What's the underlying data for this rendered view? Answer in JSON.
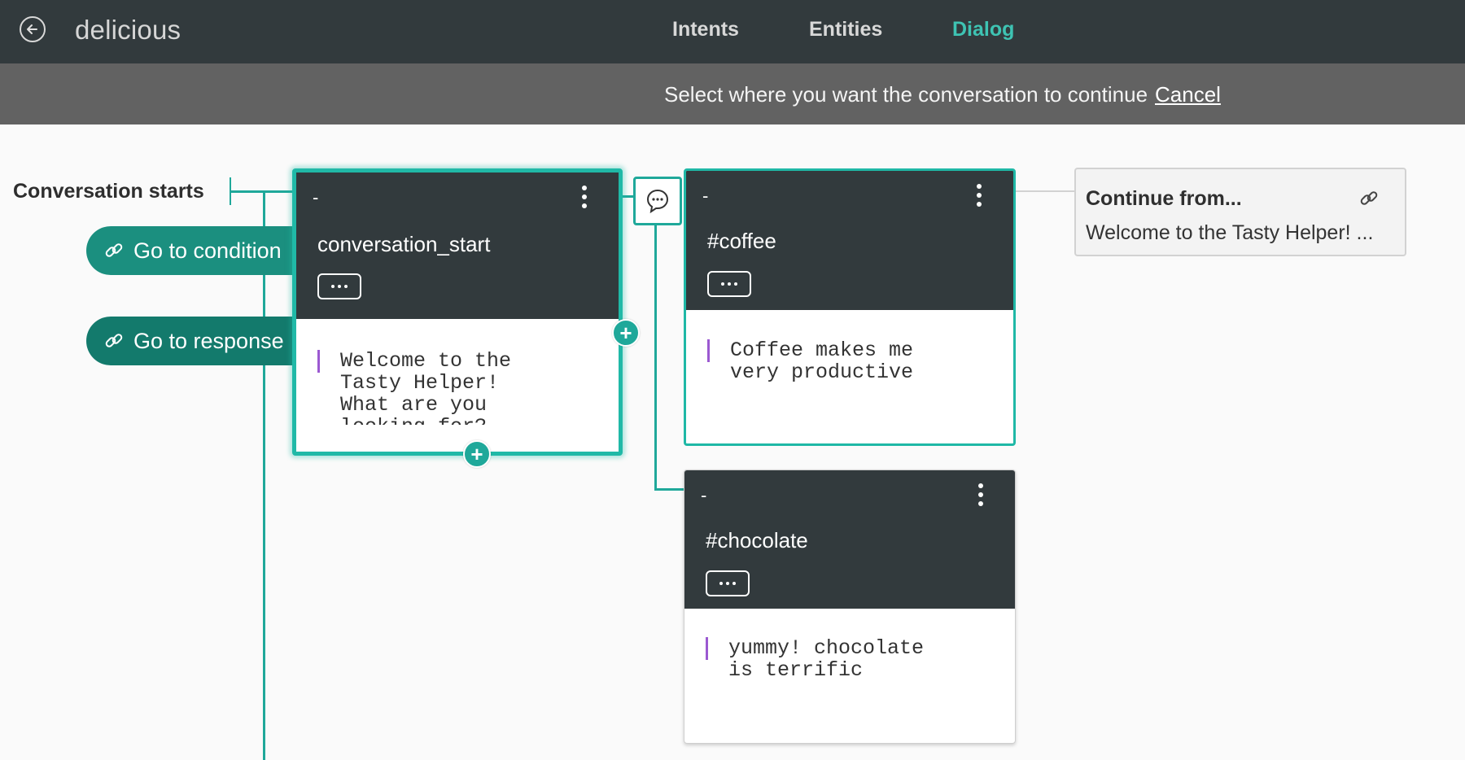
{
  "app": {
    "title": "delicious"
  },
  "nav": {
    "tabs": [
      "Intents",
      "Entities",
      "Dialog"
    ],
    "active": "Dialog"
  },
  "banner": {
    "message": "Select where you want the conversation to continue",
    "cancel": "Cancel"
  },
  "tree": {
    "start_label": "Conversation starts",
    "go_to_condition": "Go to condition",
    "go_to_response": "Go to response"
  },
  "nodes": [
    {
      "dash": "-",
      "name": "conversation_start",
      "response": "Welcome to the\nTasty Helper!\nWhat are you\nlooking for?"
    },
    {
      "dash": "-",
      "name": "#coffee",
      "response": "Coffee makes me\nvery productive"
    },
    {
      "dash": "-",
      "name": "#chocolate",
      "response": "yummy! chocolate\nis terrific"
    }
  ],
  "continue_from": {
    "title": "Continue from...",
    "text": "Welcome to the Tasty Helper! ..."
  },
  "colors": {
    "topbar": "#323a3d",
    "accent": "#3ec3b3",
    "pill": "#137a6c",
    "line": "#1fa89a",
    "response_bar": "#9b59d1"
  },
  "icons": [
    "back-arrow-icon",
    "link-icon",
    "kebab-icon",
    "ellipsis-icon",
    "plus-icon",
    "chat-bubble-icon"
  ]
}
